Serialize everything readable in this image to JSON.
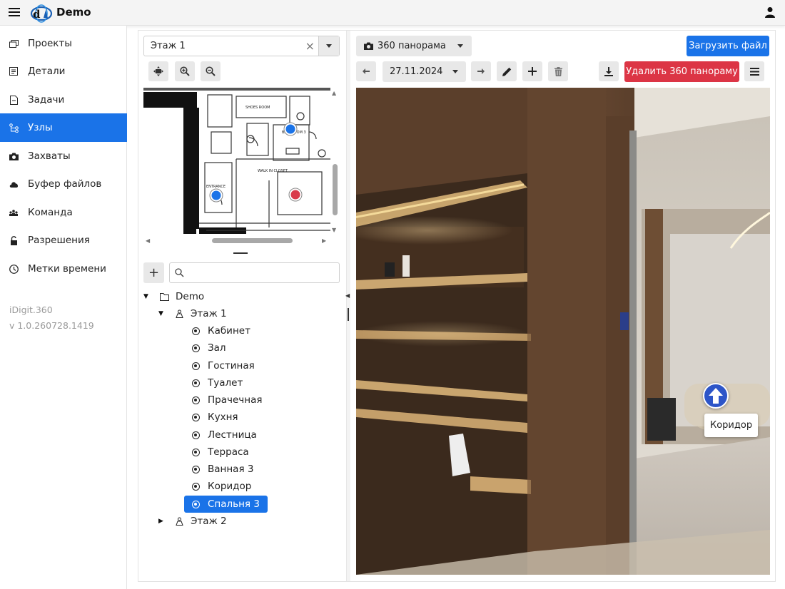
{
  "app": {
    "title": "Demo"
  },
  "sidebar": {
    "items": [
      {
        "label": "Проекты",
        "icon": "projects-icon"
      },
      {
        "label": "Детали",
        "icon": "details-icon"
      },
      {
        "label": "Задачи",
        "icon": "tasks-icon"
      },
      {
        "label": "Узлы",
        "icon": "nodes-icon",
        "active": true
      },
      {
        "label": "Захваты",
        "icon": "camera-icon"
      },
      {
        "label": "Буфер файлов",
        "icon": "cloud-icon"
      },
      {
        "label": "Команда",
        "icon": "team-icon"
      },
      {
        "label": "Разрешения",
        "icon": "lock-icon"
      },
      {
        "label": "Метки времени",
        "icon": "clock-icon"
      }
    ],
    "product": "iDigit.360",
    "version": "v 1.0.260728.1419"
  },
  "floor_select": {
    "value": "Этаж 1"
  },
  "search": {
    "placeholder": ""
  },
  "tree": {
    "root": "Demo",
    "floor1": "Этаж 1",
    "floor2": "Этаж 2",
    "nodes": [
      "Кабинет",
      "Зал",
      "Гостиная",
      "Туалет",
      "Прачечная",
      "Кухня",
      "Лестница",
      "Терраса",
      "Ванная 3",
      "Коридор",
      "Спальня 3"
    ],
    "selected": "Спальня 3"
  },
  "toolbar": {
    "pano_type": "360 панорама",
    "upload_label": "Загрузить файл",
    "date": "27.11.2024",
    "delete_label": "Удалить 360 панораму"
  },
  "plan": {
    "labels": [
      "SHOES ROOM",
      "ENTRANCE",
      "WALK IN CLOSET",
      "BATHROOM 3"
    ]
  },
  "viewer": {
    "hotspot_label": "Коридор"
  },
  "colors": {
    "accent": "#1a73e8",
    "danger": "#dc3545",
    "hotspot": "#2d55c8"
  }
}
